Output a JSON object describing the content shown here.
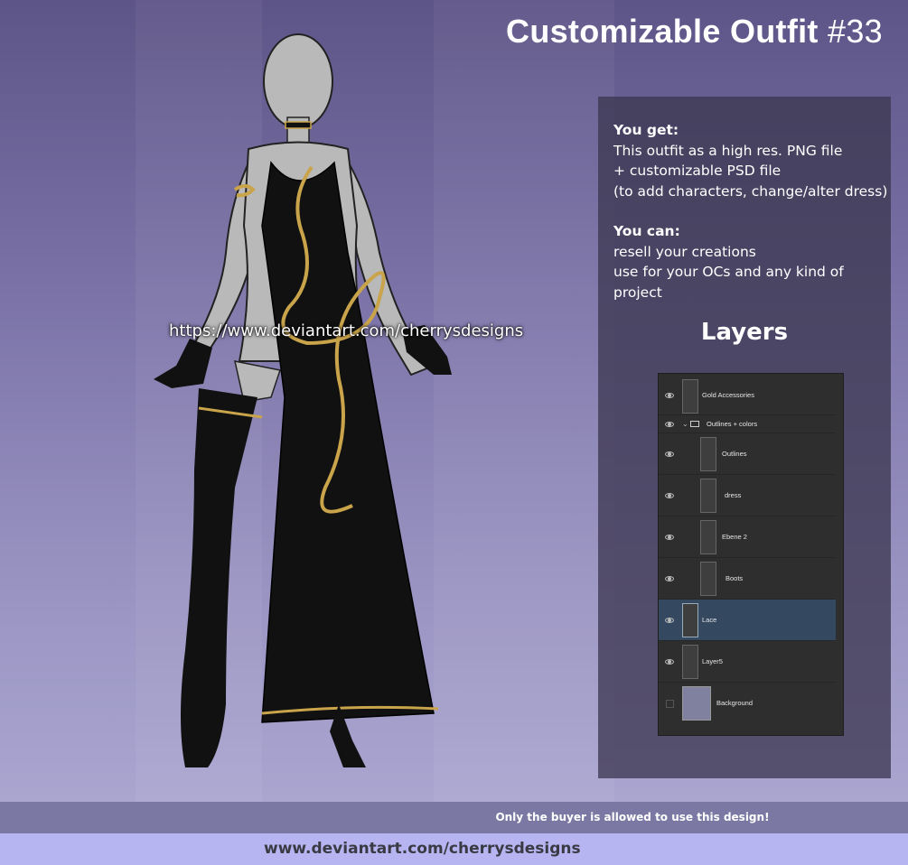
{
  "title": {
    "main": "Customizable Outfit",
    "number": "#33"
  },
  "info": {
    "you_get_heading": "You get:",
    "you_get_lines": [
      "This outfit as a high res. PNG file",
      "+ customizable PSD file",
      "(to add characters, change/alter dress)"
    ],
    "you_can_heading": "You can:",
    "you_can_lines": [
      "resell your creations",
      "use for your OCs and any kind of project"
    ],
    "layers_heading": "Layers"
  },
  "layers": [
    {
      "name": "Gold Accessories",
      "visible": true
    },
    {
      "name": "Outlines + colors",
      "visible": true,
      "group": true
    },
    {
      "name": "Outlines",
      "visible": true
    },
    {
      "name": "dress",
      "visible": true
    },
    {
      "name": "Ebene 2",
      "visible": true
    },
    {
      "name": "Boots",
      "visible": true
    },
    {
      "name": "Lace",
      "visible": true,
      "selected": true
    },
    {
      "name": "Layer5",
      "visible": true
    },
    {
      "name": "Background",
      "visible": false
    }
  ],
  "watermark": "https://www.deviantart.com/cherrysdesigns",
  "footer": {
    "notice": "Only the buyer is allowed to use this design!",
    "url": "www.deviantart.com/cherrysdesigns"
  },
  "colors": {
    "accent_gold": "#c9a44a",
    "dress": "#111111",
    "selected_layer": "#344960"
  }
}
